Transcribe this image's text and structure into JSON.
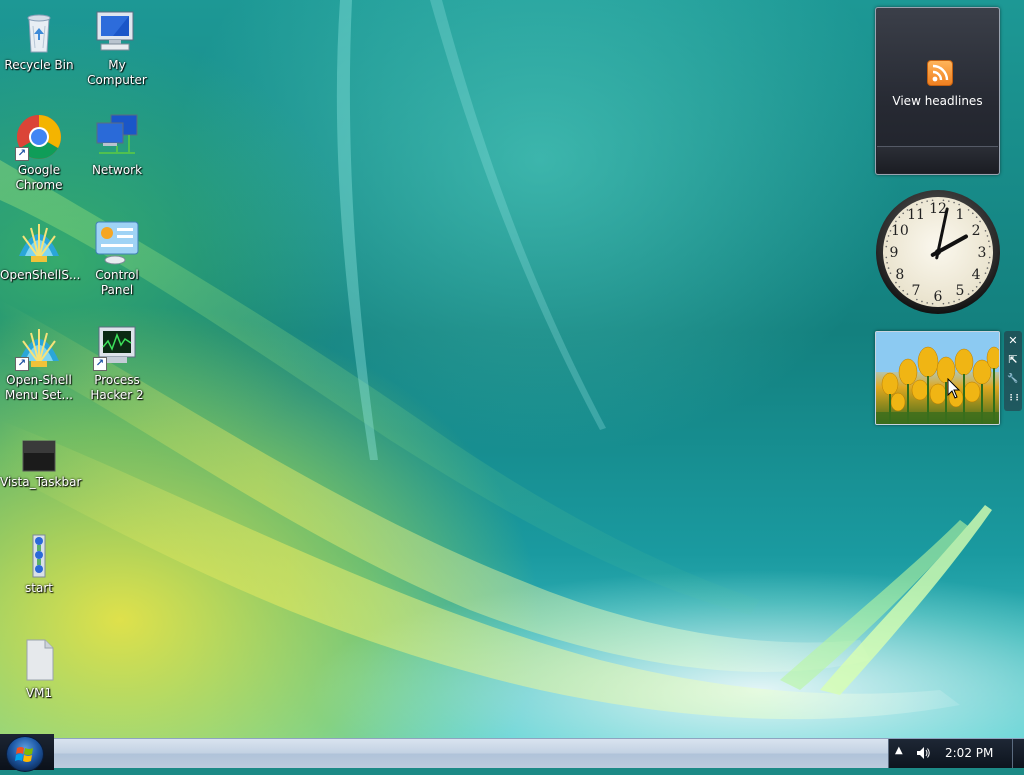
{
  "desktop": {
    "icons": [
      {
        "label": "Recycle Bin",
        "icon": "recycle-bin-icon"
      },
      {
        "label": "My Computer",
        "icon": "computer-icon"
      },
      {
        "label": "Google\nChrome",
        "icon": "chrome-icon"
      },
      {
        "label": "Network",
        "icon": "network-icon"
      },
      {
        "label": "OpenShellS...",
        "icon": "open-shell-icon"
      },
      {
        "label": "Control Panel",
        "icon": "control-panel-icon"
      },
      {
        "label": "Open-Shell\nMenu Set...",
        "icon": "open-shell-settings-icon"
      },
      {
        "label": "Process\nHacker 2",
        "icon": "process-hacker-icon"
      },
      {
        "label": "Vista_Taskbar",
        "icon": "image-file-icon"
      },
      {
        "label": "start",
        "icon": "start-app-icon"
      },
      {
        "label": "VM1",
        "icon": "file-icon"
      }
    ]
  },
  "gadgets": {
    "rss": {
      "text": "View headlines",
      "icon": "rss-icon"
    },
    "clock": {
      "hour": 2,
      "minute": 2,
      "numerals": [
        "12",
        "1",
        "2",
        "3",
        "4",
        "5",
        "6",
        "7",
        "8",
        "9",
        "10",
        "11"
      ]
    },
    "slideshow": {
      "image": "tulips-photo"
    },
    "toolbar": [
      {
        "icon": "close-icon",
        "glyph": "✕"
      },
      {
        "icon": "size-icon",
        "glyph": "⇱"
      },
      {
        "icon": "options-wrench-icon",
        "glyph": "🔧"
      },
      {
        "icon": "drag-handle-icon",
        "glyph": "⋮⋮"
      }
    ]
  },
  "taskbar": {
    "tray": {
      "time": "2:02 PM",
      "chevron": "▲",
      "volume_icon": "speaker-icon"
    }
  },
  "colors": {
    "taskbar_gradient_top": "#d9e3ef",
    "tray_bg": "#1e2735",
    "rss_orange": "#f08020"
  }
}
